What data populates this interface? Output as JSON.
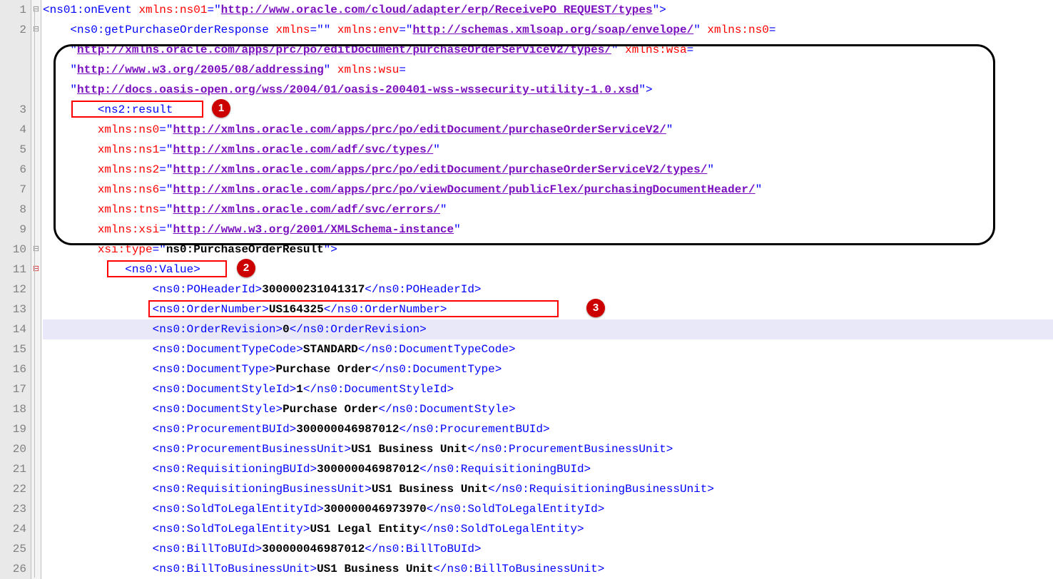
{
  "lineNumbers": [
    "1",
    "2",
    "",
    "",
    "",
    "3",
    "4",
    "5",
    "6",
    "7",
    "8",
    "9",
    "10",
    "11",
    "12",
    "13",
    "14",
    "15",
    "16",
    "17",
    "18",
    "19",
    "20",
    "21",
    "22",
    "23",
    "24",
    "25",
    "26"
  ],
  "foldMarks": [
    "⊟",
    "⊟",
    "",
    "",
    "",
    "",
    "",
    "",
    "",
    "",
    "",
    "",
    "⊟",
    "⊟",
    "",
    "",
    "",
    "",
    "",
    "",
    "",
    "",
    "",
    "",
    "",
    "",
    "",
    "",
    ""
  ],
  "rootTag": "ns01:onEvent",
  "rootAttr": "xmlns:ns01",
  "rootUrl": "http://www.oracle.com/cloud/adapter/erp/ReceivePO_REQUEST/types",
  "poRespTag": "ns0:getPurchaseOrderResponse",
  "poResp_xmlns": "xmlns",
  "poResp_envAttr": "xmlns:env",
  "poResp_envUrl": "http://schemas.xmlsoap.org/soap/envelope/",
  "poResp_ns0Attr": "xmlns:ns0",
  "poResp_ns0Url": "http://xmlns.oracle.com/apps/prc/po/editDocument/purchaseOrderServiceV2/types/",
  "poResp_wsaAttr": "xmlns:wsa",
  "poResp_wsaUrl": "http://www.w3.org/2005/08/addressing",
  "poResp_wsuAttr": "xmlns:wsu",
  "poResp_wsuUrl": "http://docs.oasis-open.org/wss/2004/01/oasis-200401-wss-wssecurity-utility-1.0.xsd",
  "resultTag": "ns2:result",
  "res_ns0Attr": "xmlns:ns0",
  "res_ns0Url": "http://xmlns.oracle.com/apps/prc/po/editDocument/purchaseOrderServiceV2/",
  "res_ns1Attr": "xmlns:ns1",
  "res_ns1Url": "http://xmlns.oracle.com/adf/svc/types/",
  "res_ns2Attr": "xmlns:ns2",
  "res_ns2Url": "http://xmlns.oracle.com/apps/prc/po/editDocument/purchaseOrderServiceV2/types/",
  "res_ns6Attr": "xmlns:ns6",
  "res_ns6Url": "http://xmlns.oracle.com/apps/prc/po/viewDocument/publicFlex/purchasingDocumentHeader/",
  "res_tnsAttr": "xmlns:tns",
  "res_tnsUrl": "http://xmlns.oracle.com/adf/svc/errors/",
  "res_xsiAttr": "xmlns:xsi",
  "res_xsiUrl": "http://www.w3.org/2001/XMLSchema-instance",
  "res_typeAttr": "xsi:type",
  "res_typeVal": "ns0:PurchaseOrderResult",
  "valueTag": "ns0:Value",
  "f12": {
    "tag": "ns0:POHeaderId",
    "val": "300000231041317"
  },
  "f13": {
    "tag": "ns0:OrderNumber",
    "val": "US164325"
  },
  "f14": {
    "tag": "ns0:OrderRevision",
    "val": "0"
  },
  "f15": {
    "tag": "ns0:DocumentTypeCode",
    "val": "STANDARD"
  },
  "f16": {
    "tag": "ns0:DocumentType",
    "val": "Purchase Order"
  },
  "f17": {
    "tag": "ns0:DocumentStyleId",
    "val": "1"
  },
  "f18": {
    "tag": "ns0:DocumentStyle",
    "val": "Purchase Order"
  },
  "f19": {
    "tag": "ns0:ProcurementBUId",
    "val": "300000046987012"
  },
  "f20": {
    "tag": "ns0:ProcurementBusinessUnit",
    "val": "US1 Business Unit"
  },
  "f21": {
    "tag": "ns0:RequisitioningBUId",
    "val": "300000046987012"
  },
  "f22": {
    "tag": "ns0:RequisitioningBusinessUnit",
    "val": "US1 Business Unit"
  },
  "f23": {
    "tag": "ns0:SoldToLegalEntityId",
    "val": "300000046973970"
  },
  "f24": {
    "tag": "ns0:SoldToLegalEntity",
    "val": "US1 Legal Entity"
  },
  "f25": {
    "tag": "ns0:BillToBUId",
    "val": "300000046987012"
  },
  "f26": {
    "tag": "ns0:BillToBusinessUnit",
    "val": "US1 Business Unit"
  },
  "badges": {
    "b1": "1",
    "b2": "2",
    "b3": "3"
  }
}
